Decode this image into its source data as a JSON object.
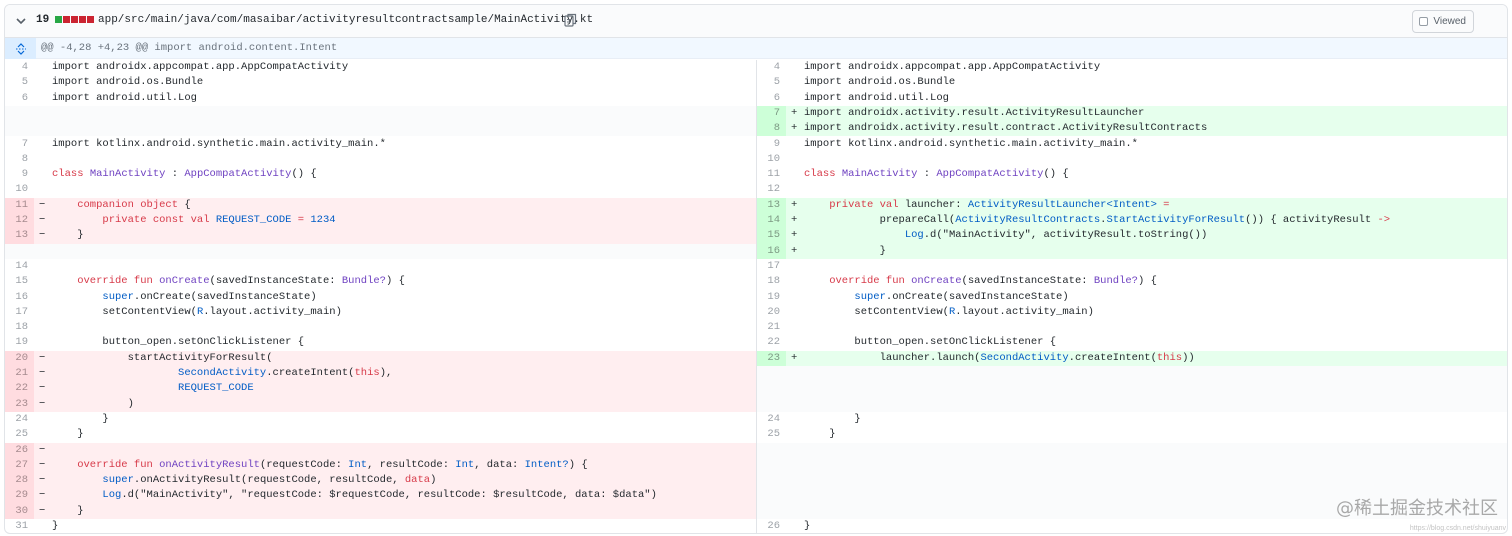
{
  "file": {
    "change_count": "19",
    "diffstat_colors": [
      "#28a745",
      "#cb2431",
      "#cb2431",
      "#cb2431",
      "#cb2431"
    ],
    "path": "app/src/main/java/com/masaibar/activityresultcontractsample/MainActivity.kt",
    "viewed_label": "Viewed"
  },
  "hunk": {
    "header": "@@ -4,28 +4,23 @@ import android.content.Intent"
  },
  "left_lines": [
    {
      "n": "4",
      "t": "ctx",
      "s": [
        [
          "",
          "import androidx.appcompat.app.AppCompatActivity"
        ]
      ]
    },
    {
      "n": "5",
      "t": "ctx",
      "s": [
        [
          "",
          "import android.os.Bundle"
        ]
      ]
    },
    {
      "n": "6",
      "t": "ctx",
      "s": [
        [
          "",
          "import android.util.Log"
        ]
      ]
    },
    {
      "n": "",
      "t": "empty",
      "s": []
    },
    {
      "n": "",
      "t": "empty",
      "s": []
    },
    {
      "n": "7",
      "t": "ctx",
      "s": [
        [
          "",
          "import kotlinx.android.synthetic.main.activity_main.*"
        ]
      ]
    },
    {
      "n": "8",
      "t": "ctx",
      "s": []
    },
    {
      "n": "9",
      "t": "ctx",
      "s": [
        [
          "kw",
          "class "
        ],
        [
          "fn",
          "MainActivity"
        ],
        [
          "",
          " : "
        ],
        [
          "fn",
          "AppCompatActivity"
        ],
        [
          "",
          "() {"
        ]
      ]
    },
    {
      "n": "10",
      "t": "ctx",
      "s": []
    },
    {
      "n": "11",
      "t": "del",
      "s": [
        [
          "kw",
          "    companion object"
        ],
        [
          "",
          " {"
        ]
      ]
    },
    {
      "n": "12",
      "t": "del",
      "s": [
        [
          "kw",
          "        private const val "
        ],
        [
          "ty",
          "REQUEST_CODE"
        ],
        [
          "kw",
          " = "
        ],
        [
          "ty",
          "1234"
        ]
      ]
    },
    {
      "n": "13",
      "t": "del",
      "s": [
        [
          "",
          "    }"
        ]
      ]
    },
    {
      "n": "",
      "t": "empty",
      "s": []
    },
    {
      "n": "14",
      "t": "ctx",
      "s": []
    },
    {
      "n": "15",
      "t": "ctx",
      "s": [
        [
          "kw",
          "    override fun "
        ],
        [
          "fn",
          "onCreate"
        ],
        [
          "",
          "(savedInstanceState: "
        ],
        [
          "fn",
          "Bundle?"
        ],
        [
          "",
          ") {"
        ]
      ]
    },
    {
      "n": "16",
      "t": "ctx",
      "s": [
        [
          "ty",
          "        super"
        ],
        [
          "",
          ".onCreate(savedInstanceState)"
        ]
      ]
    },
    {
      "n": "17",
      "t": "ctx",
      "s": [
        [
          "",
          "        setContentView("
        ],
        [
          "ty",
          "R"
        ],
        [
          "",
          ".layout.activity_main)"
        ]
      ]
    },
    {
      "n": "18",
      "t": "ctx",
      "s": []
    },
    {
      "n": "19",
      "t": "ctx",
      "s": [
        [
          "",
          "        button_open.setOnClickListener {"
        ]
      ]
    },
    {
      "n": "20",
      "t": "del",
      "s": [
        [
          "",
          "            startActivityForResult("
        ]
      ]
    },
    {
      "n": "21",
      "t": "del",
      "s": [
        [
          "ty",
          "                    SecondActivity"
        ],
        [
          "",
          ".createIntent("
        ],
        [
          "kw",
          "this"
        ],
        [
          "",
          "),"
        ]
      ]
    },
    {
      "n": "22",
      "t": "del",
      "s": [
        [
          "ty",
          "                    REQUEST_CODE"
        ]
      ]
    },
    {
      "n": "23",
      "t": "del",
      "s": [
        [
          "",
          "            )"
        ]
      ]
    },
    {
      "n": "24",
      "t": "ctx",
      "s": [
        [
          "",
          "        }"
        ]
      ]
    },
    {
      "n": "25",
      "t": "ctx",
      "s": [
        [
          "",
          "    }"
        ]
      ]
    },
    {
      "n": "26",
      "t": "del",
      "s": []
    },
    {
      "n": "27",
      "t": "del",
      "s": [
        [
          "kw",
          "    override fun "
        ],
        [
          "fn",
          "onActivityResult"
        ],
        [
          "",
          "(requestCode: "
        ],
        [
          "ty",
          "Int"
        ],
        [
          "",
          ", resultCode: "
        ],
        [
          "ty",
          "Int"
        ],
        [
          "",
          ", data: "
        ],
        [
          "ty",
          "Intent?"
        ],
        [
          "",
          ") {"
        ]
      ]
    },
    {
      "n": "28",
      "t": "del",
      "s": [
        [
          "ty",
          "        super"
        ],
        [
          "",
          ".onActivityResult(requestCode, resultCode, "
        ],
        [
          "kw",
          "data"
        ],
        [
          "",
          ")"
        ]
      ]
    },
    {
      "n": "29",
      "t": "del",
      "s": [
        [
          "ty",
          "        Log"
        ],
        [
          "",
          ".d(\"MainActivity\", \"requestCode: $requestCode, resultCode: $resultCode, data: $data\")"
        ]
      ]
    },
    {
      "n": "30",
      "t": "del",
      "s": [
        [
          "",
          "    }"
        ]
      ]
    },
    {
      "n": "31",
      "t": "ctx",
      "s": [
        [
          "",
          "}"
        ]
      ]
    }
  ],
  "right_lines": [
    {
      "n": "4",
      "t": "ctx",
      "s": [
        [
          "",
          "import androidx.appcompat.app.AppCompatActivity"
        ]
      ]
    },
    {
      "n": "5",
      "t": "ctx",
      "s": [
        [
          "",
          "import android.os.Bundle"
        ]
      ]
    },
    {
      "n": "6",
      "t": "ctx",
      "s": [
        [
          "",
          "import android.util.Log"
        ]
      ]
    },
    {
      "n": "7",
      "t": "add",
      "s": [
        [
          "",
          "import androidx.activity.result.ActivityResultLauncher"
        ]
      ]
    },
    {
      "n": "8",
      "t": "add",
      "s": [
        [
          "",
          "import androidx.activity.result.contract.ActivityResultContracts"
        ]
      ]
    },
    {
      "n": "9",
      "t": "ctx",
      "s": [
        [
          "",
          "import kotlinx.android.synthetic.main.activity_main.*"
        ]
      ]
    },
    {
      "n": "10",
      "t": "ctx",
      "s": []
    },
    {
      "n": "11",
      "t": "ctx",
      "s": [
        [
          "kw",
          "class "
        ],
        [
          "fn",
          "MainActivity"
        ],
        [
          "",
          " : "
        ],
        [
          "fn",
          "AppCompatActivity"
        ],
        [
          "",
          "() {"
        ]
      ]
    },
    {
      "n": "12",
      "t": "ctx",
      "s": []
    },
    {
      "n": "13",
      "t": "add",
      "s": [
        [
          "kw",
          "    private val "
        ],
        [
          "",
          "launcher: "
        ],
        [
          "ty",
          "ActivityResultLauncher<Intent>"
        ],
        [
          "kw",
          " ="
        ]
      ]
    },
    {
      "n": "14",
      "t": "add",
      "s": [
        [
          "",
          "            prepareCall("
        ],
        [
          "ty",
          "ActivityResultContracts"
        ],
        [
          "",
          "."
        ],
        [
          "ty",
          "StartActivityForResult"
        ],
        [
          "",
          "()) { activityResult "
        ],
        [
          "kw",
          "->"
        ]
      ]
    },
    {
      "n": "15",
      "t": "add",
      "s": [
        [
          "ty",
          "                Log"
        ],
        [
          "",
          ".d(\"MainActivity\", activityResult.toString())"
        ]
      ]
    },
    {
      "n": "16",
      "t": "add",
      "s": [
        [
          "",
          "            }"
        ]
      ]
    },
    {
      "n": "17",
      "t": "ctx",
      "s": []
    },
    {
      "n": "18",
      "t": "ctx",
      "s": [
        [
          "kw",
          "    override fun "
        ],
        [
          "fn",
          "onCreate"
        ],
        [
          "",
          "(savedInstanceState: "
        ],
        [
          "fn",
          "Bundle?"
        ],
        [
          "",
          ") {"
        ]
      ]
    },
    {
      "n": "19",
      "t": "ctx",
      "s": [
        [
          "ty",
          "        super"
        ],
        [
          "",
          ".onCreate(savedInstanceState)"
        ]
      ]
    },
    {
      "n": "20",
      "t": "ctx",
      "s": [
        [
          "",
          "        setContentView("
        ],
        [
          "ty",
          "R"
        ],
        [
          "",
          ".layout.activity_main)"
        ]
      ]
    },
    {
      "n": "21",
      "t": "ctx",
      "s": []
    },
    {
      "n": "22",
      "t": "ctx",
      "s": [
        [
          "",
          "        button_open.setOnClickListener {"
        ]
      ]
    },
    {
      "n": "23",
      "t": "add",
      "s": [
        [
          "",
          "            launcher.launch("
        ],
        [
          "ty",
          "SecondActivity"
        ],
        [
          "",
          ".createIntent("
        ],
        [
          "kw",
          "this"
        ],
        [
          "",
          "))"
        ]
      ]
    },
    {
      "n": "",
      "t": "empty",
      "s": []
    },
    {
      "n": "",
      "t": "empty",
      "s": []
    },
    {
      "n": "",
      "t": "empty",
      "s": []
    },
    {
      "n": "24",
      "t": "ctx",
      "s": [
        [
          "",
          "        }"
        ]
      ]
    },
    {
      "n": "25",
      "t": "ctx",
      "s": [
        [
          "",
          "    }"
        ]
      ]
    },
    {
      "n": "",
      "t": "empty",
      "s": []
    },
    {
      "n": "",
      "t": "empty",
      "s": []
    },
    {
      "n": "",
      "t": "empty",
      "s": []
    },
    {
      "n": "",
      "t": "empty",
      "s": []
    },
    {
      "n": "",
      "t": "empty",
      "s": []
    },
    {
      "n": "26",
      "t": "ctx",
      "s": [
        [
          "",
          "}"
        ]
      ]
    }
  ],
  "watermark": {
    "text": "@稀土掘金技术社区",
    "url": "https://blog.csdn.net/shuiyuanv"
  }
}
